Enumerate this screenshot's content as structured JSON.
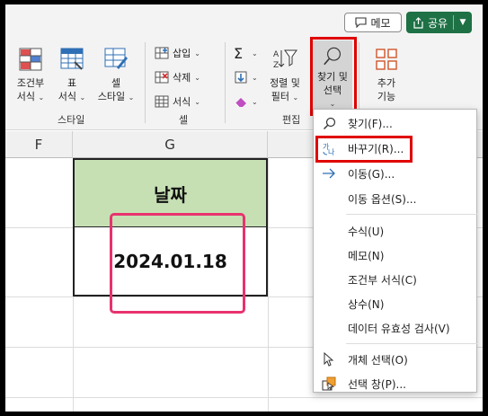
{
  "topbar": {
    "memo_label": "메모",
    "share_label": "공유"
  },
  "ribbon": {
    "style_group": {
      "label": "스타일",
      "cond_format": [
        "조건부",
        "서식"
      ],
      "table_format": [
        "표",
        "서식"
      ],
      "cell_style": [
        "셀",
        "스타일"
      ]
    },
    "cells_group": {
      "label": "셀",
      "insert": "삽입",
      "delete": "삭제",
      "format": "서식"
    },
    "edit_group": {
      "label": "편집",
      "sort_filter": [
        "정렬 및",
        "필터"
      ],
      "find_select": [
        "찾기 및",
        "선택"
      ]
    },
    "addins": [
      "추가",
      "기능"
    ]
  },
  "grid": {
    "columns": [
      "F",
      "G"
    ],
    "header_cell": "날짜",
    "value_cell": "2024.01.18"
  },
  "menu": {
    "items": [
      {
        "label": "찾기(F)...",
        "icon": "search-icon"
      },
      {
        "label": "바꾸기(R)...",
        "icon": "replace-icon"
      },
      {
        "label": "이동(G)...",
        "icon": "arrow-right-icon"
      },
      {
        "label": "이동 옵션(S)...",
        "icon": ""
      },
      {
        "label": "수식(U)",
        "icon": ""
      },
      {
        "label": "메모(N)",
        "icon": ""
      },
      {
        "label": "조건부 서식(C)",
        "icon": ""
      },
      {
        "label": "상수(N)",
        "icon": ""
      },
      {
        "label": "데이터 유효성 검사(V)",
        "icon": ""
      },
      {
        "label": "개체 선택(O)",
        "icon": "pointer-icon"
      },
      {
        "label": "선택 창(P)...",
        "icon": "selection-pane-icon"
      }
    ]
  },
  "colors": {
    "share_green": "#1e7145",
    "header_fill": "#c6e0b4",
    "highlight_red": "#e00000",
    "highlight_pink": "#e8326e"
  }
}
